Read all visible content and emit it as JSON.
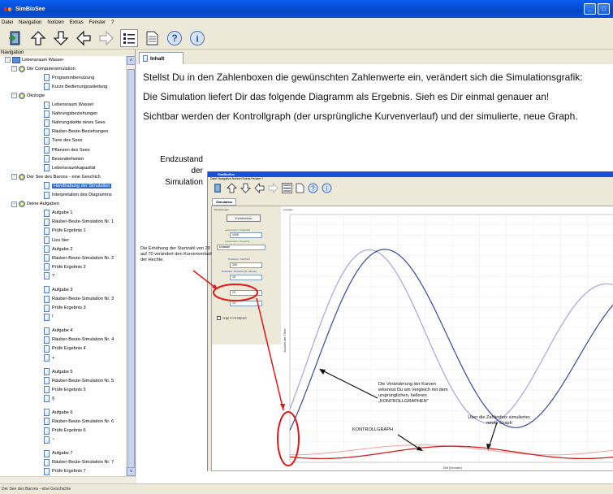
{
  "app": {
    "title": "SimBioSee"
  },
  "menu": [
    "Datei",
    "Navigation",
    "Notizen",
    "Extras",
    "Fenster",
    "?"
  ],
  "sidebar": {
    "header": "Navigation",
    "items": [
      {
        "label": "Lebensraum Wasser",
        "level": 0,
        "type": "folder",
        "expander": "-"
      },
      {
        "label": "Die Computersimulation",
        "level": 1,
        "type": "bulb",
        "expander": "-"
      },
      {
        "label": "Programmbenutzung",
        "level": 2,
        "type": "doc"
      },
      {
        "label": "Kurze Bedienungsanleitung",
        "level": 2,
        "type": "doc"
      },
      {
        "label": "Ökologie",
        "level": 1,
        "type": "bulb",
        "expander": "-"
      },
      {
        "label": "Lebensraum Wasser",
        "level": 2,
        "type": "doc"
      },
      {
        "label": "Nahrungsbeziehungen",
        "level": 2,
        "type": "doc"
      },
      {
        "label": "Nahrungskette eines Sees",
        "level": 2,
        "type": "doc"
      },
      {
        "label": "Räuber-Beute-Beziehungen",
        "level": 2,
        "type": "doc"
      },
      {
        "label": "Tiere des Sees",
        "level": 2,
        "type": "doc"
      },
      {
        "label": "Pflanzen des Sees",
        "level": 2,
        "type": "doc"
      },
      {
        "label": "Besonderheiten",
        "level": 2,
        "type": "doc"
      },
      {
        "label": "Lebensraumkapazität",
        "level": 2,
        "type": "doc"
      },
      {
        "label": "Der See des Barons - eine Geschich",
        "level": 1,
        "type": "bulb",
        "expander": "-"
      },
      {
        "label": "Handhabung der Simulation",
        "level": 2,
        "type": "doc",
        "selected": true
      },
      {
        "label": "Interpretation des Diagramms",
        "level": 2,
        "type": "doc"
      },
      {
        "label": "Deine Aufgaben",
        "level": 1,
        "type": "bulb",
        "expander": "-"
      },
      {
        "label": "Aufgabe 1",
        "level": 2,
        "type": "doc"
      },
      {
        "label": "Räuber-Beute-Simulation Nr. 1",
        "level": 2,
        "type": "doc"
      },
      {
        "label": "Prüfe Ergebnis 1",
        "level": 2,
        "type": "doc"
      },
      {
        "label": "Lies hier",
        "level": 2,
        "type": "doc"
      },
      {
        "label": "Aufgabe 2",
        "level": 2,
        "type": "doc"
      },
      {
        "label": "Räuber-Beute-Simulation Nr. 2",
        "level": 2,
        "type": "doc"
      },
      {
        "label": "Prüfe Ergebnis 2",
        "level": 2,
        "type": "doc"
      },
      {
        "label": "?",
        "level": 2,
        "type": "doc",
        "tall": true
      },
      {
        "label": "Aufgabe 3",
        "level": 2,
        "type": "doc"
      },
      {
        "label": "Räuber-Beute-Simulation Nr. 3",
        "level": 2,
        "type": "doc"
      },
      {
        "label": "Prüfe Ergebnis 3",
        "level": 2,
        "type": "doc"
      },
      {
        "label": "!",
        "level": 2,
        "type": "doc",
        "tall": true
      },
      {
        "label": "Aufgabe 4",
        "level": 2,
        "type": "doc"
      },
      {
        "label": "Räuber-Beute-Simulation Nr. 4",
        "level": 2,
        "type": "doc"
      },
      {
        "label": "Prüfe Ergebnis 4",
        "level": 2,
        "type": "doc"
      },
      {
        "label": "+",
        "level": 2,
        "type": "doc",
        "tall": true
      },
      {
        "label": "Aufgabe 5",
        "level": 2,
        "type": "doc"
      },
      {
        "label": "Räuber-Beute-Simulation Nr. 5",
        "level": 2,
        "type": "doc"
      },
      {
        "label": "Prüfe Ergebnis 5",
        "level": 2,
        "type": "doc"
      },
      {
        "label": "§",
        "level": 2,
        "type": "doc",
        "tall": true
      },
      {
        "label": "Aufgabe 6",
        "level": 2,
        "type": "doc"
      },
      {
        "label": "Räuber-Beute-Simulation Nr. 6",
        "level": 2,
        "type": "doc"
      },
      {
        "label": "Prüfe Ergebnis 6",
        "level": 2,
        "type": "doc"
      },
      {
        "label": "~",
        "level": 2,
        "type": "doc",
        "tall": true
      },
      {
        "label": "Aufgabe 7",
        "level": 2,
        "type": "doc"
      },
      {
        "label": "Räuber-Beute-Simulation Nr. 7",
        "level": 2,
        "type": "doc"
      },
      {
        "label": "Prüfe Ergebnis 7",
        "level": 2,
        "type": "doc"
      }
    ]
  },
  "main": {
    "tab": "Inhalt",
    "paragraphs": [
      "Stellst Du in den Zahlenboxen die gewünschten Zahlenwerte ein, verändert sich die Simulationsgrafik:",
      "Die Simulation liefert Dir das folgende Diagramm als Ergebnis. Sieh es Dir einmal genauer an!",
      "Sichtbar werden der Kontrollgraph (der ursprüngliche Kurvenverlauf) und der simulierte, neue Graph."
    ],
    "endzustand_line1": "Endzustand",
    "endzustand_line2": "der Simulation",
    "annotation_left": "Die Erhöhung der Startzahl von 20 auf 70 verändert den Kurvenverlauf der Hechte.",
    "annotation_compare": "Die Veränderung der Kurven erkennst Du am Vergleich mit dem ursprünglichen, helleren „KONTROLLGRAPHEN\"",
    "annotation_new": "Über die Zahlenbox simulierter, neuer Graph",
    "kontroll_label": "KONTROLLGRAPH"
  },
  "inner": {
    "title": "SimBioSee",
    "menu": "Datei   Navigation   Notizen   Extras   Fenster   ?",
    "tab": "Simulation",
    "settings_label": "Einstellungen",
    "reset_button": "Zurücksetzen",
    "output_label": "Ausgabe",
    "cap_label": "Lebensraum: Kapazität",
    "cap_value": "1000",
    "prey_label": "Lebensraum: Zuwachs",
    "prey_value": "konstant",
    "rot_label": "Rotfedern: Startzahl",
    "rot_value": "200",
    "rot2_label": "Rotfedern: Zuwachs [% / Monat]",
    "rot2_value": "15",
    "hecht_value": "70",
    "hecht2_value": "10",
    "checkbox_label": "zeige Kontrollgraph",
    "yaxis": "Anzahl der Tiere",
    "xaxis": "Zeit [Monate]"
  },
  "status": "Der See des Barons - eine Geschichte",
  "colors": {
    "titlebar": "#0a5ff0",
    "selection": "#316ac5",
    "graph_blue": "#3848a0",
    "graph_light": "#b0b0e0",
    "graph_red": "#d02020"
  }
}
